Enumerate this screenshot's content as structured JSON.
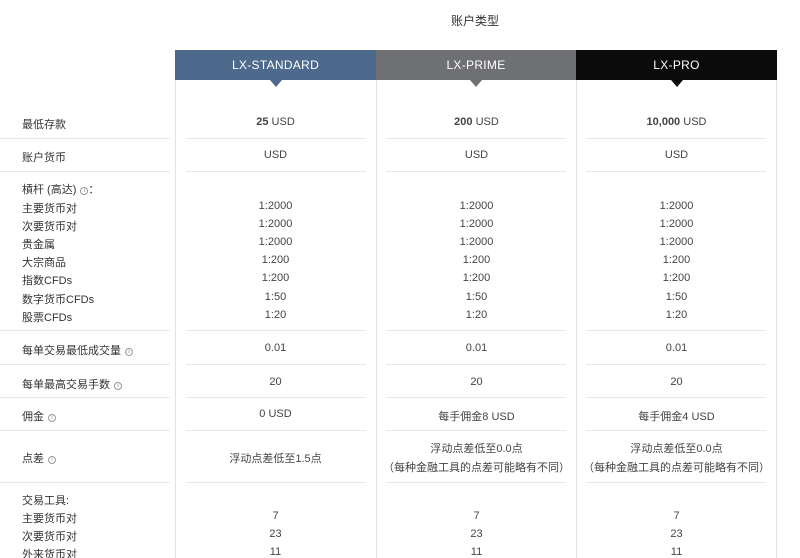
{
  "header": {
    "title": "账户类型"
  },
  "plans": [
    {
      "name": "LX-STANDARD"
    },
    {
      "name": "LX-PRIME"
    },
    {
      "name": "LX-PRO"
    }
  ],
  "rows": {
    "min_deposit": {
      "label": "最低存款",
      "values": [
        [
          "25",
          " USD"
        ],
        [
          "200",
          " USD"
        ],
        [
          "10,000",
          " USD"
        ]
      ]
    },
    "currency": {
      "label": "账户货币",
      "values": [
        "USD",
        "USD",
        "USD"
      ]
    },
    "leverage": {
      "label": "槓杆 (高达)",
      "suffix": "：",
      "items": [
        {
          "label": "主要货币对",
          "values": [
            "1:2000",
            "1:2000",
            "1:2000"
          ]
        },
        {
          "label": "次要货币对",
          "values": [
            "1:2000",
            "1:2000",
            "1:2000"
          ]
        },
        {
          "label": "贵金属",
          "values": [
            "1:2000",
            "1:2000",
            "1:2000"
          ]
        },
        {
          "label": "大宗商品",
          "values": [
            "1:200",
            "1:200",
            "1:200"
          ]
        },
        {
          "label": "指数CFDs",
          "values": [
            "1:200",
            "1:200",
            "1:200"
          ]
        },
        {
          "label": "数字货币CFDs",
          "values": [
            "1:50",
            "1:50",
            "1:50"
          ]
        },
        {
          "label": "股票CFDs",
          "values": [
            "1:20",
            "1:20",
            "1:20"
          ]
        }
      ]
    },
    "min_volume": {
      "label": "每单交易最低成交量",
      "values": [
        "0.01",
        "0.01",
        "0.01"
      ]
    },
    "max_lots": {
      "label": "每单最高交易手数",
      "values": [
        "20",
        "20",
        "20"
      ]
    },
    "commission": {
      "label": "佣金",
      "values": [
        "0 USD",
        "每手佣金8 USD",
        "每手佣金4 USD"
      ]
    },
    "spread": {
      "label": "点差",
      "values": [
        [
          "浮动点差低至1.5点",
          ""
        ],
        [
          "浮动点差低至0.0点",
          "（每种金融工具的点差可能略有不同）"
        ],
        [
          "浮动点差低至0.0点",
          "（每种金融工具的点差可能略有不同）"
        ]
      ]
    },
    "instruments": {
      "label": "交易工具:",
      "items": [
        {
          "label": "主要货币对",
          "values": [
            "7",
            "7",
            "7"
          ]
        },
        {
          "label": "次要货币对",
          "values": [
            "23",
            "23",
            "23"
          ]
        },
        {
          "label": "外来货币对",
          "values": [
            "11",
            "11",
            "11"
          ]
        }
      ]
    }
  },
  "info_icon_glyph": "i",
  "colors": {
    "standard": "#4d6a8c",
    "prime": "#6f7073",
    "pro": "#0b0b0b"
  }
}
